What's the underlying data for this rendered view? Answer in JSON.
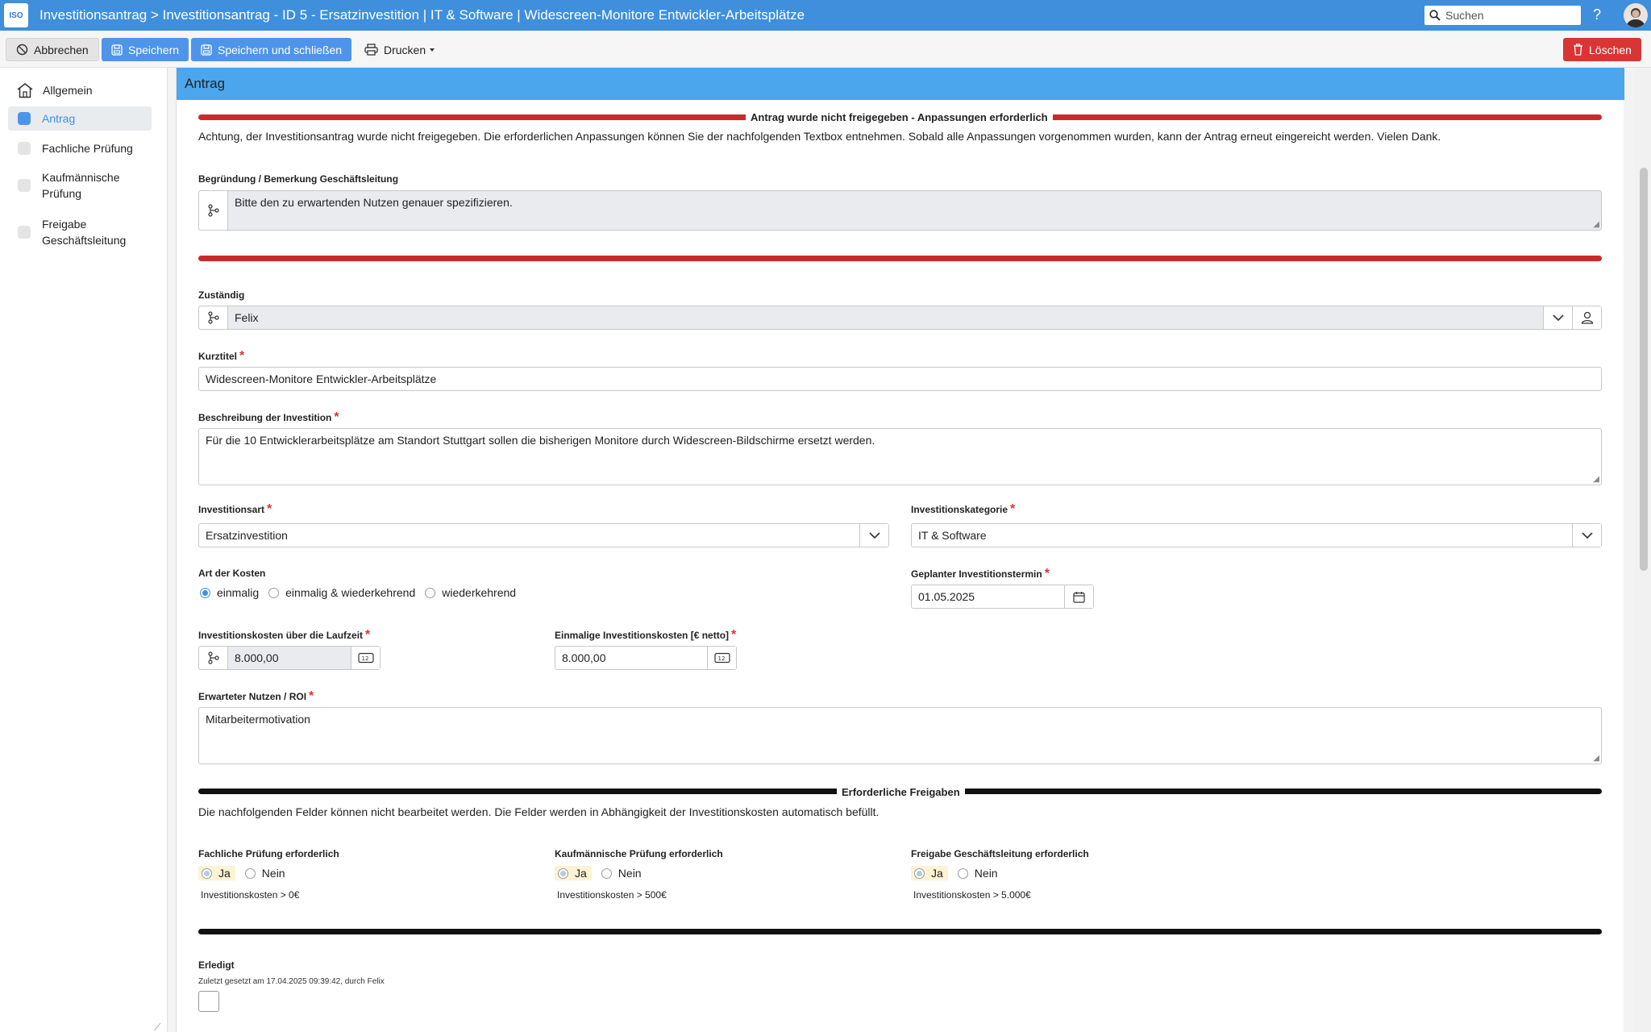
{
  "titlebar": {
    "logo": "ISO",
    "title": "Investitionsantrag > Investitionsantrag - ID 5 - Ersatzinvestition | IT & Software | Widescreen-Monitore Entwickler-Arbeitsplätze",
    "search_placeholder": "Suchen",
    "help": "?"
  },
  "toolbar": {
    "cancel": "Abbrechen",
    "save": "Speichern",
    "save_close": "Speichern und schließen",
    "print": "Drucken",
    "delete": "Löschen"
  },
  "sidebar": {
    "items": [
      {
        "label": "Allgemein"
      },
      {
        "label": "Antrag"
      },
      {
        "label": "Fachliche Prüfung"
      },
      {
        "label_line1": "Kaufmännische",
        "label_line2": "Prüfung"
      },
      {
        "label_line1": "Freigabe",
        "label_line2": "Geschäftsleitung"
      }
    ]
  },
  "main": {
    "header": "Antrag",
    "warning_title": "Antrag wurde nicht freigegeben - Anpassungen erforderlich",
    "warning_text": "Achtung, der Investitionsantrag wurde nicht freigegeben. Die erforderlichen Anpassungen können Sie der nachfolgenden Textbox entnehmen. Sobald alle Anpassungen vorgenommen wurden, kann der Antrag erneut eingereicht werden. Vielen Dank.",
    "begruendung_label": "Begründung / Bemerkung Geschäftsleitung",
    "begruendung_value": "Bitte den zu erwartenden Nutzen genauer spezifizieren.",
    "zustaendig_label": "Zuständig",
    "zustaendig_value": "Felix",
    "kurztitel_label": "Kurztitel",
    "kurztitel_value": "Widescreen-Monitore Entwickler-Arbeitsplätze",
    "beschreibung_label": "Beschreibung der Investition",
    "beschreibung_value": "Für die 10 Entwicklerarbeitsplätze am Standort Stuttgart sollen die bisherigen Monitore durch Widescreen-Bildschirme ersetzt werden.",
    "investitionsart_label": "Investitionsart",
    "investitionsart_value": "Ersatzinvestition",
    "investitionskategorie_label": "Investitionskategorie",
    "investitionskategorie_value": "IT & Software",
    "kostenart_label": "Art der Kosten",
    "kostenart_options": [
      "einmalig",
      "einmalig & wiederkehrend",
      "wiederkehrend"
    ],
    "kostenart_selected": "einmalig",
    "termin_label": "Geplanter Investitionstermin",
    "termin_value": "01.05.2025",
    "kosten_laufzeit_label": "Investitionskosten über die Laufzeit",
    "kosten_laufzeit_value": "8.000,00",
    "einmalig_kosten_label": "Einmalige Investitionskosten [€ netto]",
    "einmalig_kosten_value": "8.000,00",
    "nutzen_label": "Erwarteter Nutzen / ROI",
    "nutzen_value": "Mitarbeitermotivation",
    "freigaben_title": "Erforderliche Freigaben",
    "freigaben_text": "Die nachfolgenden Felder können nicht bearbeitet werden. Die Felder werden in Abhängigkeit der Investitionskosten automatisch befüllt.",
    "approvals": [
      {
        "label": "Fachliche Prüfung erforderlich",
        "yes": "Ja",
        "no": "Nein",
        "hint": "Investitionskosten > 0€"
      },
      {
        "label": "Kaufmännische Prüfung erforderlich",
        "yes": "Ja",
        "no": "Nein",
        "hint": "Investitionskosten > 500€"
      },
      {
        "label": "Freigabe Geschäftsleitung erforderlich",
        "yes": "Ja",
        "no": "Nein",
        "hint": "Investitionskosten > 5.000€"
      }
    ],
    "erledigt_label": "Erledigt",
    "erledigt_meta": "Zuletzt gesetzt am 17.04.2025 09:39:42, durch Felix",
    "required_mark": "*"
  },
  "colors": {
    "titlebar": "#3f8fdc",
    "header": "#4ba6ee",
    "primary_button": "#4e95ea",
    "delete_button": "#d93535",
    "warning_separator": "#c92a2a"
  }
}
